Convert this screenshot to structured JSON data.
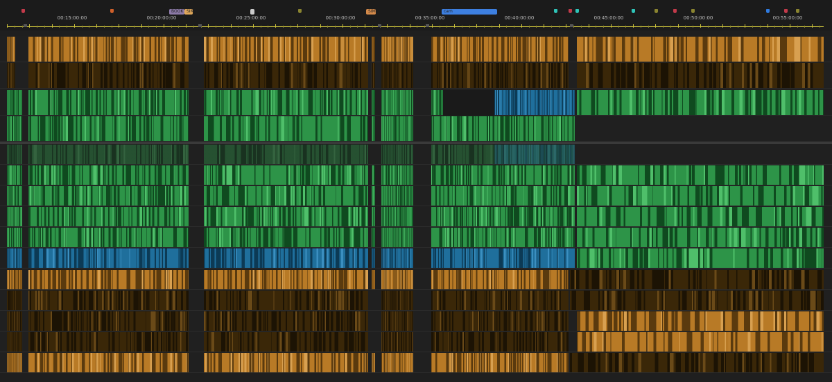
{
  "timeline": {
    "timecodes": [
      "00:15:00:00",
      "00:20:00:00",
      "00:25:00:00",
      "00:30:00:00",
      "00:35:00:00",
      "00:40:00:00",
      "00:45:00:00",
      "00:50:00:00",
      "00:55:00:00"
    ],
    "clip_markers": [
      {
        "label": "BOOK",
        "color": "#8c7aa8"
      },
      {
        "label": "SIM",
        "color": "#e0a85a"
      },
      {
        "label": "",
        "color": "#cccccc"
      },
      {
        "label": "SIM",
        "color": "#d48a4a"
      },
      {
        "label": "cam",
        "color": "#3d7fe0"
      }
    ],
    "marker_colors": [
      "#c33a4a",
      "#d0602a",
      "#8a8430",
      "#2fc4b8",
      "#2f7be0"
    ]
  },
  "colors": {
    "orange": "#b87a26",
    "orange_dark": "#3a2708",
    "green": "#2d9448",
    "blue": "#1f6f9c",
    "background": "#1f1f1f",
    "ruler_line": "#c8bf3a"
  }
}
